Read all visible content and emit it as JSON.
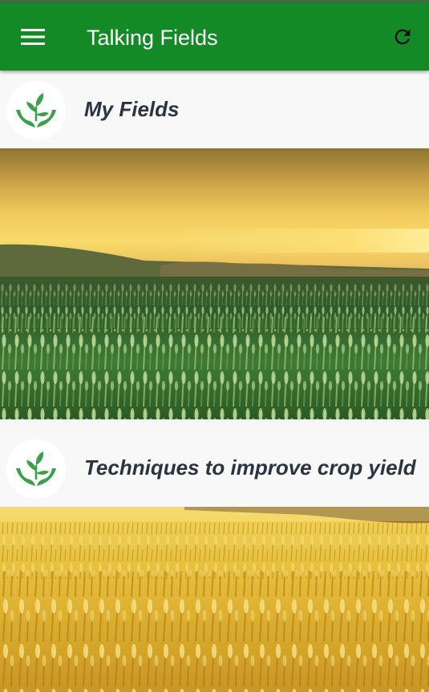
{
  "app": {
    "title": "Talking Fields",
    "colors": {
      "app_bar": "#138a25",
      "title_text": "#ffffff",
      "card_title": "#2b3440",
      "logo_green": "#3aa14a"
    },
    "icons": {
      "menu": "hamburger-menu-icon",
      "refresh": "refresh-icon",
      "logo": "hands-holding-sprout-icon"
    }
  },
  "cards": [
    {
      "title": "My Fields",
      "image": "green-wheat-field-at-sunset"
    },
    {
      "title": "Techniques to improve crop yield",
      "image": "golden-wheat-field"
    }
  ]
}
